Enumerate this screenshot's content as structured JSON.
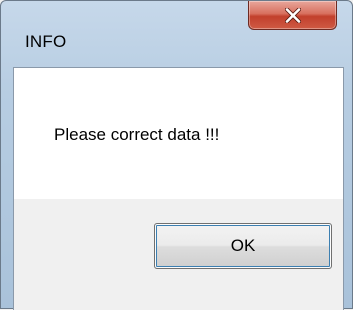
{
  "window": {
    "title": "INFO"
  },
  "dialog": {
    "message": "Please correct data !!!",
    "ok_label": "OK"
  },
  "icons": {
    "close": "close-icon"
  },
  "colors": {
    "close_button": "#c7442f",
    "ok_focus_ring": "#3c7fb1",
    "message_background": "#ffffff",
    "button_area_background": "#f0f0f0"
  }
}
